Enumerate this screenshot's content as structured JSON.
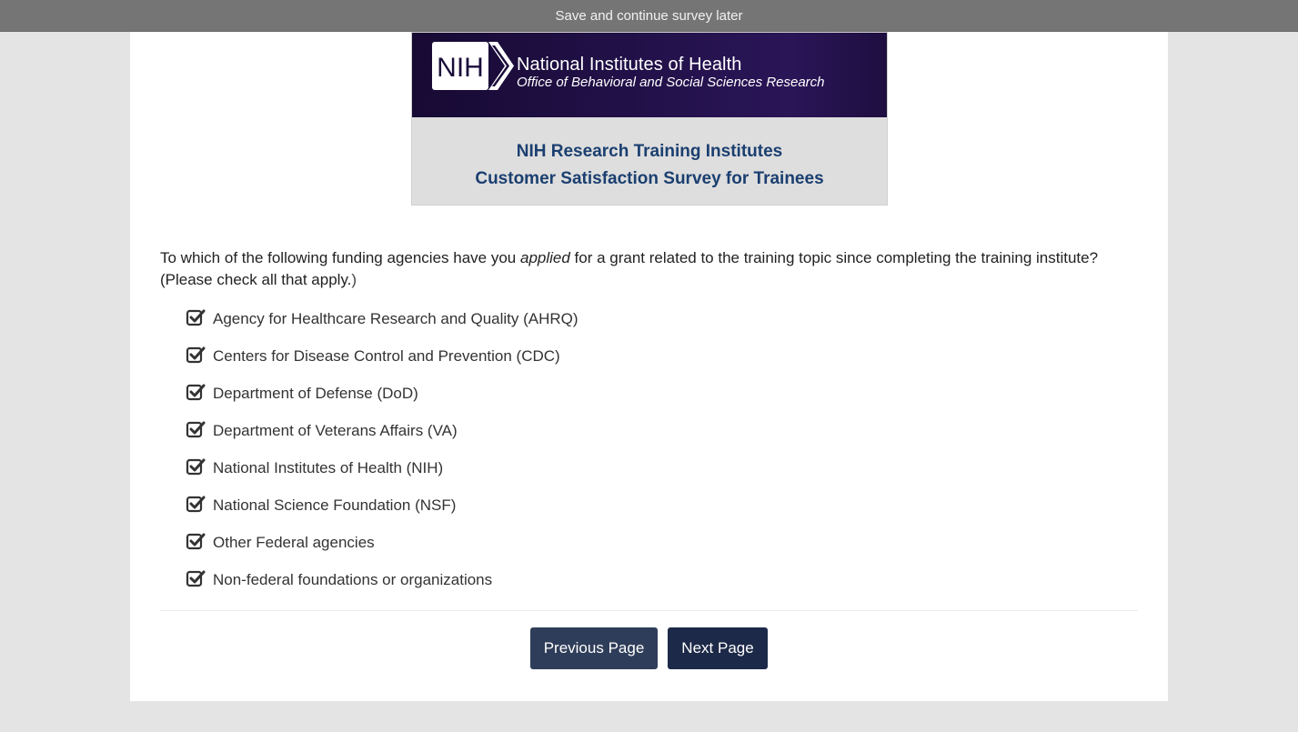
{
  "topbar": {
    "save_label": "Save and continue survey later"
  },
  "banner": {
    "logo_text": "NIH",
    "org_name": "National Institutes of Health",
    "office_name": "Office of Behavioral and Social Sciences Research",
    "title_line1": "NIH Research Training Institutes",
    "title_line2": "Customer Satisfaction Survey for Trainees"
  },
  "question": {
    "part1": "To which of the following funding agencies have you ",
    "emphasis": "applied",
    "part2": " for a grant related to the training topic since completing the training institute? (Please check all that apply.",
    "part3": ")"
  },
  "options": [
    {
      "label": "Agency for Healthcare Research and Quality (AHRQ)",
      "checked": true
    },
    {
      "label": "Centers for Disease Control and Prevention (CDC)",
      "checked": true
    },
    {
      "label": "Department of Defense (DoD)",
      "checked": true
    },
    {
      "label": "Department of Veterans Affairs (VA)",
      "checked": true
    },
    {
      "label": "National Institutes of Health (NIH)",
      "checked": true
    },
    {
      "label": "National Science Foundation (NSF)",
      "checked": true
    },
    {
      "label": "Other Federal agencies",
      "checked": true
    },
    {
      "label": "Non-federal foundations or organizations",
      "checked": true
    }
  ],
  "nav": {
    "prev_label": "Previous Page",
    "next_label": "Next Page"
  },
  "colors": {
    "button": "#2e3d59",
    "banner_title": "#1b3f70",
    "topbar": "#757575"
  }
}
